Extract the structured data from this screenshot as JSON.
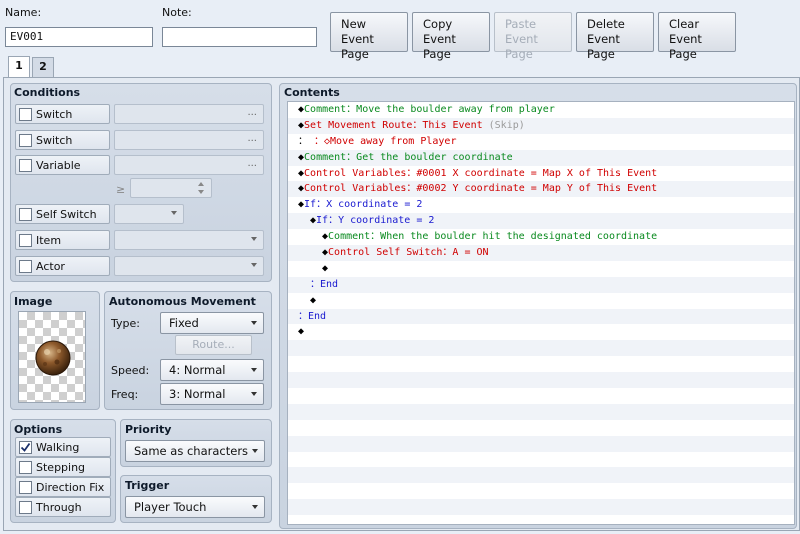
{
  "header": {
    "name_label": "Name:",
    "name_value": "EV001",
    "note_label": "Note:",
    "note_value": ""
  },
  "toolbar": {
    "new_l1": "New",
    "new_l2": "Event Page",
    "copy_l1": "Copy",
    "copy_l2": "Event Page",
    "paste_l1": "Paste",
    "paste_l2": "Event Page",
    "delete_l1": "Delete",
    "delete_l2": "Event Page",
    "clear_l1": "Clear",
    "clear_l2": "Event Page"
  },
  "tabs": [
    "1",
    "2"
  ],
  "conditions": {
    "title": "Conditions",
    "switch1": "Switch",
    "switch2": "Switch",
    "variable": "Variable",
    "gte": "≥",
    "self_switch": "Self Switch",
    "item": "Item",
    "actor": "Actor",
    "ellipsis": "..."
  },
  "image": {
    "title": "Image"
  },
  "autonomous": {
    "title": "Autonomous Movement",
    "type_label": "Type:",
    "type_value": "Fixed",
    "route_button": "Route...",
    "speed_label": "Speed:",
    "speed_value": "4: Normal",
    "freq_label": "Freq:",
    "freq_value": "3: Normal"
  },
  "options": {
    "title": "Options",
    "walking": "Walking",
    "walking_checked": true,
    "stepping": "Stepping",
    "direction_fix": "Direction Fix",
    "through": "Through"
  },
  "priority": {
    "title": "Priority",
    "value": "Same as characters"
  },
  "trigger": {
    "title": "Trigger",
    "value": "Player Touch"
  },
  "contents": {
    "title": "Contents",
    "lines": [
      {
        "indent": 0,
        "parts": [
          [
            "◆",
            "black"
          ],
          [
            "Comment：Move the boulder away from player",
            "green"
          ]
        ]
      },
      {
        "indent": 0,
        "parts": [
          [
            "◆",
            "black"
          ],
          [
            "Set Movement Route：This Event ",
            "red"
          ],
          [
            "(Skip)",
            "gray"
          ]
        ]
      },
      {
        "indent": 0,
        "parts": [
          [
            "：",
            "black"
          ],
          [
            "                    ：◇Move away from Player",
            "red"
          ]
        ]
      },
      {
        "indent": 0,
        "parts": [
          [
            "◆",
            "black"
          ],
          [
            "Comment：Get the boulder coordinate",
            "green"
          ]
        ]
      },
      {
        "indent": 0,
        "parts": [
          [
            "◆",
            "black"
          ],
          [
            "Control Variables：#0001 X coordinate = Map X of This Event",
            "red"
          ]
        ]
      },
      {
        "indent": 0,
        "parts": [
          [
            "◆",
            "black"
          ],
          [
            "Control Variables：#0002 Y coordinate = Map Y of This Event",
            "red"
          ]
        ]
      },
      {
        "indent": 0,
        "parts": [
          [
            "◆",
            "black"
          ],
          [
            "If：X coordinate = 2",
            "blue"
          ]
        ]
      },
      {
        "indent": 1,
        "parts": [
          [
            "◆",
            "black"
          ],
          [
            "If：Y coordinate = 2",
            "blue"
          ]
        ]
      },
      {
        "indent": 2,
        "parts": [
          [
            "◆",
            "black"
          ],
          [
            "Comment：When the boulder hit the designated coordinate",
            "green"
          ]
        ]
      },
      {
        "indent": 2,
        "parts": [
          [
            "◆",
            "black"
          ],
          [
            "Control Self Switch：A = ON",
            "red"
          ]
        ]
      },
      {
        "indent": 2,
        "parts": [
          [
            "◆",
            "black"
          ]
        ]
      },
      {
        "indent": 1,
        "parts": [
          [
            "：End",
            "blue"
          ]
        ]
      },
      {
        "indent": 1,
        "parts": [
          [
            "◆",
            "black"
          ]
        ]
      },
      {
        "indent": 0,
        "parts": [
          [
            "：End",
            "blue"
          ]
        ]
      },
      {
        "indent": 0,
        "parts": [
          [
            "◆",
            "black"
          ]
        ]
      }
    ],
    "total_rows": 26
  }
}
